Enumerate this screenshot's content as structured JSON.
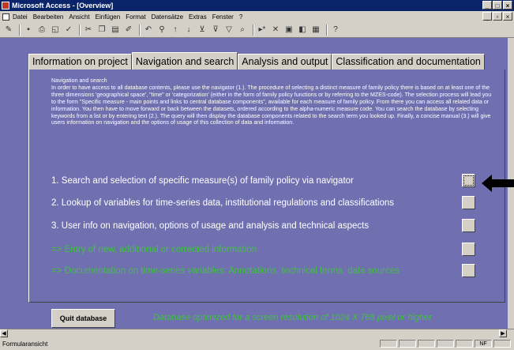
{
  "window": {
    "title": "Microsoft Access - [Overview]"
  },
  "menu": [
    "Datei",
    "Bearbeiten",
    "Ansicht",
    "Einfügen",
    "Format",
    "Datensätze",
    "Extras",
    "Fenster",
    "?"
  ],
  "tabs": [
    "Information on project",
    "Navigation and search",
    "Analysis and output",
    "Classification and documentation"
  ],
  "intro": {
    "title": "Navigation and search",
    "body": "In order to have access to all database contents, please use the navigator (1.). The procedure of selecting a distinct measure of family policy there is based on at least one of the three dimensions 'geographical space', \"time\" or 'categorization' (either in the form of family policy functions or by referring to the MZES-code). The selection process will lead you to the form \"Specific measure - main points and links to central database components\", available for each measure of family policy. From there you can access all related data or information. You then have to move forward or back between the datasets, ordered according to the alpha-numeric measure code. You can search the database by selecting keywords from a list or by entering text (2.). The query will then display the database components related to the search term you looked up. Finally, a concise manual (3.) will give users information on navigation and the options of usage of this collection of data and information."
  },
  "options": [
    "1. Search and selection of specific measure(s) of family policy via navigator",
    "2. Lookup of variables for time-series data, institutional regulations and classifications",
    "3. User info on navigation, options of usage and analysis and technical aspects",
    "=> Entry of new, additional or corrected information",
    "=> Documentation on time-series variables: Annotations, technical terms, data sources"
  ],
  "quit_label": "Quit database",
  "optimized_note": "Database optimized for a screen resolution of 1024 X 768 pixel or higher",
  "status": {
    "left": "Formularansicht",
    "nf": "NF"
  },
  "colors": {
    "form_bg": "#7070b0",
    "green_text": "#3fc23f",
    "titlebar": "#0a246a"
  }
}
